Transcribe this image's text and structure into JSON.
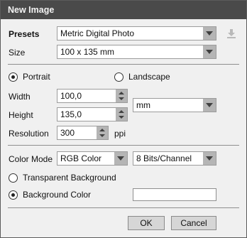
{
  "window": {
    "title": "New Image"
  },
  "presets": {
    "label": "Presets",
    "value": "Metric Digital Photo"
  },
  "size": {
    "label": "Size",
    "value": "100 x 135 mm"
  },
  "orientation": {
    "portrait_label": "Portrait",
    "landscape_label": "Landscape",
    "selected": "portrait"
  },
  "width": {
    "label": "Width",
    "value": "100,0"
  },
  "height": {
    "label": "Height",
    "value": "135,0"
  },
  "units": {
    "value": "mm"
  },
  "resolution": {
    "label": "Resolution",
    "value": "300",
    "unit": "ppi"
  },
  "color_mode": {
    "label": "Color Mode",
    "value": "RGB Color",
    "depth": "8 Bits/Channel"
  },
  "background": {
    "transparent_label": "Transparent Background",
    "color_label": "Background Color",
    "selected": "color",
    "color": "#ffffff"
  },
  "buttons": {
    "ok": "OK",
    "cancel": "Cancel"
  },
  "icons": {
    "save_preset": "download-icon"
  }
}
